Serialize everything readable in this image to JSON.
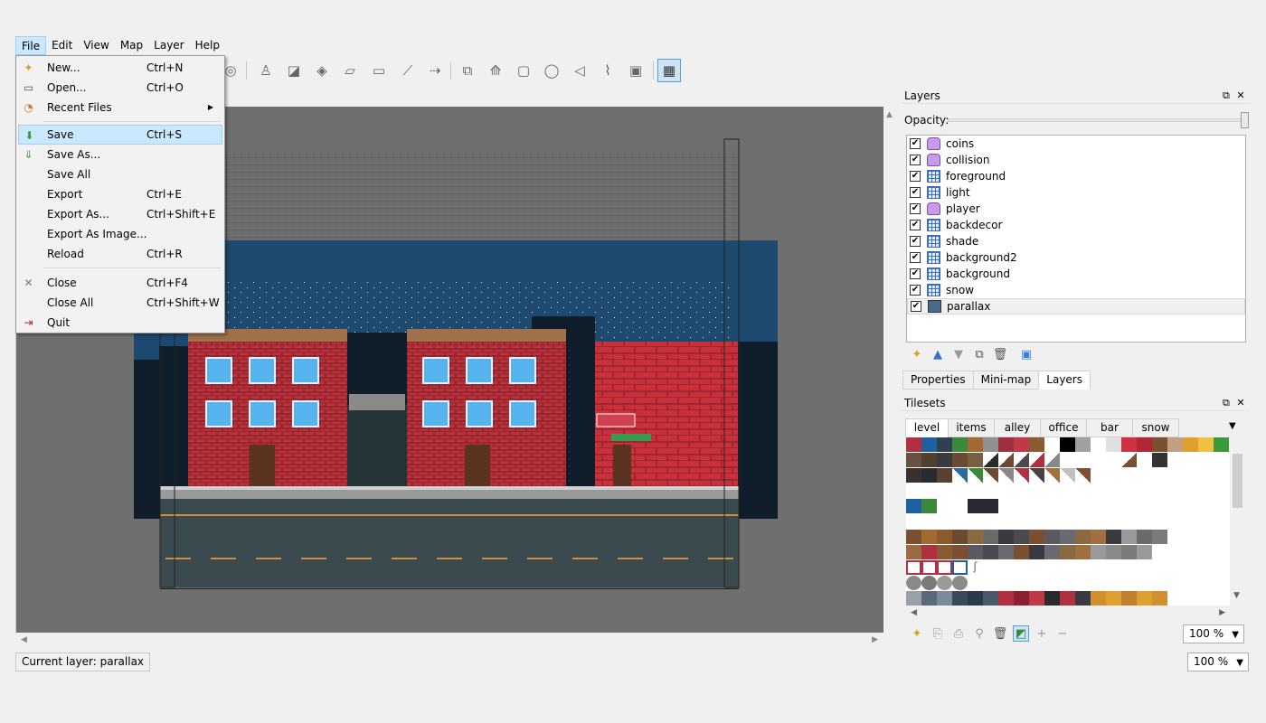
{
  "menubar": {
    "items": [
      "File",
      "Edit",
      "View",
      "Map",
      "Layer",
      "Help"
    ]
  },
  "file_menu": {
    "items": [
      {
        "label": "New...",
        "shortcut": "Ctrl+N",
        "icon": "new-file-icon"
      },
      {
        "label": "Open...",
        "shortcut": "Ctrl+O",
        "icon": "open-folder-icon"
      },
      {
        "label": "Recent Files",
        "shortcut": "",
        "icon": "recent-files-icon",
        "submenu": true
      },
      {
        "label": "Save",
        "shortcut": "Ctrl+S",
        "icon": "save-icon",
        "highlighted": true
      },
      {
        "label": "Save As...",
        "shortcut": "",
        "icon": "save-as-icon"
      },
      {
        "label": "Save All",
        "shortcut": "",
        "icon": ""
      },
      {
        "label": "Export",
        "shortcut": "Ctrl+E",
        "icon": ""
      },
      {
        "label": "Export As...",
        "shortcut": "Ctrl+Shift+E",
        "icon": ""
      },
      {
        "label": "Export As Image...",
        "shortcut": "",
        "icon": ""
      },
      {
        "label": "Reload",
        "shortcut": "Ctrl+R",
        "icon": ""
      },
      {
        "label": "Close",
        "shortcut": "Ctrl+F4",
        "icon": "close-x-icon"
      },
      {
        "label": "Close All",
        "shortcut": "Ctrl+Shift+W",
        "icon": ""
      },
      {
        "label": "Quit",
        "shortcut": "",
        "icon": "quit-icon"
      }
    ]
  },
  "layers_panel": {
    "title": "Layers",
    "opacity_label": "Opacity:",
    "opacity": 1.0,
    "layers": [
      {
        "name": "coins",
        "type": "object",
        "visible": true
      },
      {
        "name": "collision",
        "type": "object",
        "visible": true
      },
      {
        "name": "foreground",
        "type": "tile",
        "visible": true
      },
      {
        "name": "light",
        "type": "tile",
        "visible": true
      },
      {
        "name": "player",
        "type": "object",
        "visible": true
      },
      {
        "name": "backdecor",
        "type": "tile",
        "visible": true
      },
      {
        "name": "shade",
        "type": "tile",
        "visible": true
      },
      {
        "name": "background2",
        "type": "tile",
        "visible": true
      },
      {
        "name": "background",
        "type": "tile",
        "visible": true
      },
      {
        "name": "snow",
        "type": "tile",
        "visible": true
      },
      {
        "name": "parallax",
        "type": "image",
        "visible": true,
        "selected": true
      }
    ],
    "tabs": [
      "Properties",
      "Mini-map",
      "Layers"
    ],
    "active_tab": "Layers"
  },
  "tilesets_panel": {
    "title": "Tilesets",
    "tabs": [
      "level",
      "items",
      "alley",
      "office",
      "bar",
      "snow"
    ],
    "active_tab": "level",
    "zoom": "100 %"
  },
  "statusbar": {
    "current_layer": "Current layer: parallax",
    "zoom": "100 %"
  },
  "colors": {
    "sky": "#1d4a6e",
    "brick": "#b8303a",
    "road": "#3a4a4e",
    "roof": "#a0714a"
  }
}
